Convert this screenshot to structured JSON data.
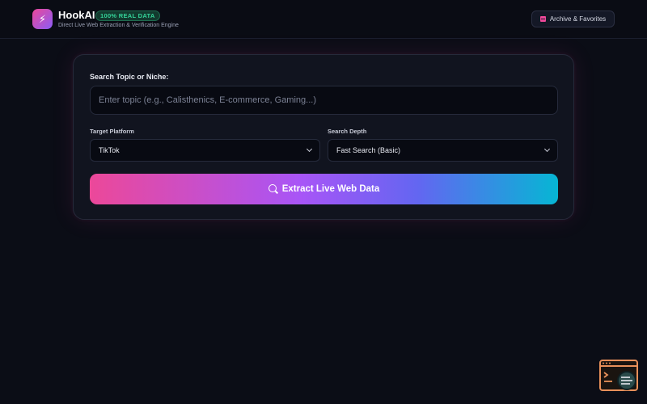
{
  "app": {
    "brand": "HookAI",
    "badge": "100% REAL DATA",
    "tagline": "Direct Live Web Extraction & Verification Engine"
  },
  "header": {
    "archive_label": "Archive & Favorites"
  },
  "search": {
    "topic_label": "Search Topic or Niche:",
    "topic_placeholder": "Enter topic (e.g., Calisthenics, E-commerce, Gaming...)",
    "topic_value": "",
    "platform_label": "Target Platform",
    "platform_value": "TikTok",
    "depth_label": "Search Depth",
    "depth_value": "Fast Search (Basic)",
    "extract_label": "Extract Live Web Data"
  },
  "icons": {
    "logo": "lightning-bolt-icon",
    "archive": "archive-box-icon",
    "search": "search-icon",
    "widget": "browser-inspect-icon"
  },
  "colors": {
    "accent_pink": "#ec4899",
    "accent_purple": "#a855f7",
    "accent_cyan": "#06b6d4",
    "badge_green": "#34d399",
    "background": "#0b0d16"
  }
}
